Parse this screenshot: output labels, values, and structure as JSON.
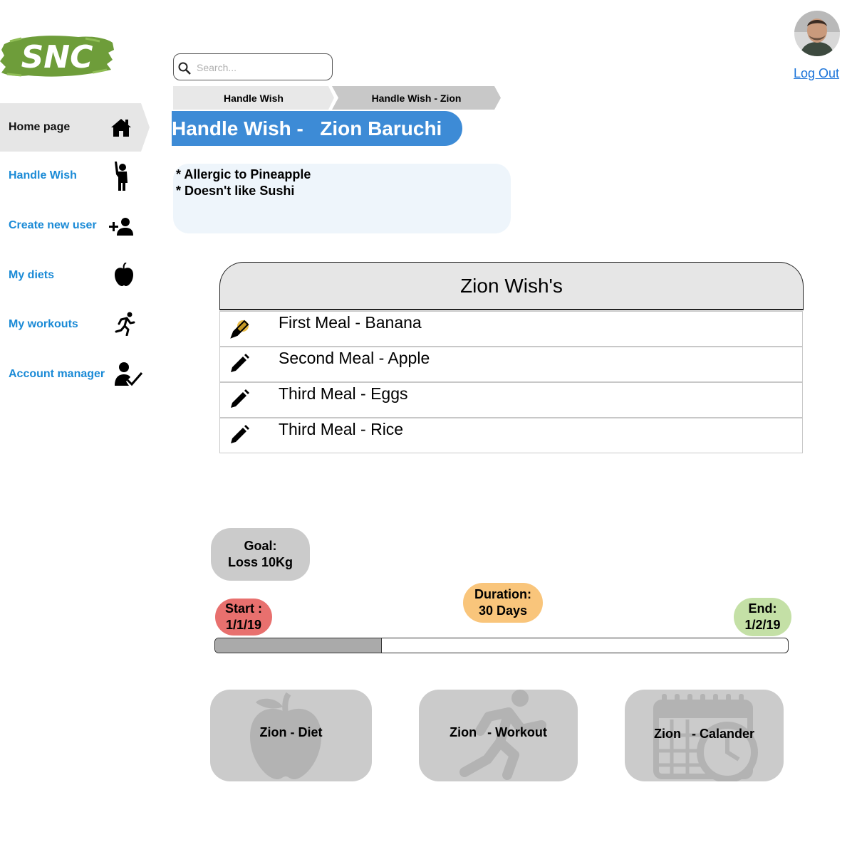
{
  "brand": {
    "logo_text": "SNC"
  },
  "search": {
    "placeholder": "Search..."
  },
  "header": {
    "logout_label": "Log Out"
  },
  "breadcrumbs": [
    {
      "label": "Handle Wish"
    },
    {
      "label": "Handle Wish - Zion"
    }
  ],
  "page": {
    "title": "Handle Wish -   Zion Baruchi",
    "notes": [
      "* Allergic to Pineapple",
      "* Doesn't like Sushi"
    ]
  },
  "sidebar": {
    "items": [
      {
        "label": "Home page",
        "icon": "home-icon"
      },
      {
        "label": "Handle Wish",
        "icon": "raised-hand-person-icon"
      },
      {
        "label": "Create new user",
        "icon": "add-user-icon"
      },
      {
        "label": "My diets",
        "icon": "apple-icon"
      },
      {
        "label": "My workouts",
        "icon": "running-person-icon"
      },
      {
        "label": "Account manager",
        "icon": "user-check-icon"
      }
    ]
  },
  "wishes": {
    "header": "Zion Wish's",
    "rows": [
      {
        "text": "First Meal - Banana",
        "icon": "pencil-icon"
      },
      {
        "text": "Second Meal - Apple",
        "icon": "pencil-icon"
      },
      {
        "text": "Third Meal - Eggs",
        "icon": "pencil-icon"
      },
      {
        "text": "Third Meal - Rice",
        "icon": "pencil-icon"
      }
    ]
  },
  "goal": {
    "line1": "Goal:",
    "line2": "Loss 10Kg"
  },
  "timeline": {
    "start_label": "Start :",
    "start_date": "1/1/19",
    "duration_label": "Duration:",
    "duration_value": "30 Days",
    "end_label": "End:",
    "end_date": "1/2/19",
    "progress_fraction": 0.29
  },
  "cards": [
    {
      "label": "Zion - Diet",
      "icon": "apple-icon"
    },
    {
      "label": "Zion   - Workout",
      "icon": "running-person-icon"
    },
    {
      "label": "Zion   - Calander",
      "icon": "calendar-clock-icon"
    }
  ],
  "colors": {
    "accent": "#3d8bd6",
    "link": "#1a8ad6",
    "start": "#e8706e",
    "duration": "#f9c57b",
    "end": "#c4e0a6",
    "logo_green": "#6e9d3a"
  }
}
